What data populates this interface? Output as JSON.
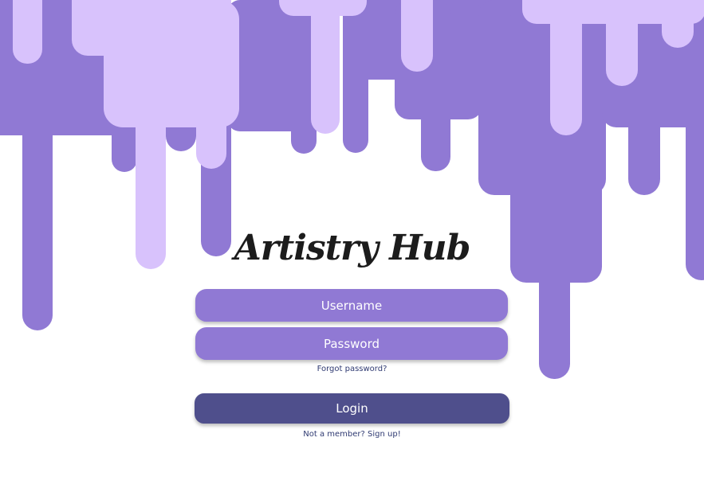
{
  "app": {
    "title": "Artistry Hub"
  },
  "form": {
    "username_placeholder": "Username",
    "password_placeholder": "Password",
    "forgot_password": "Forgot password?",
    "login_label": "Login",
    "signup_text": "Not a member? Sign up!"
  },
  "colors": {
    "drip_dark": "#9079d4",
    "drip_light": "#d8c2fc",
    "button": "#4f4f8c",
    "link": "#2f3a72"
  }
}
